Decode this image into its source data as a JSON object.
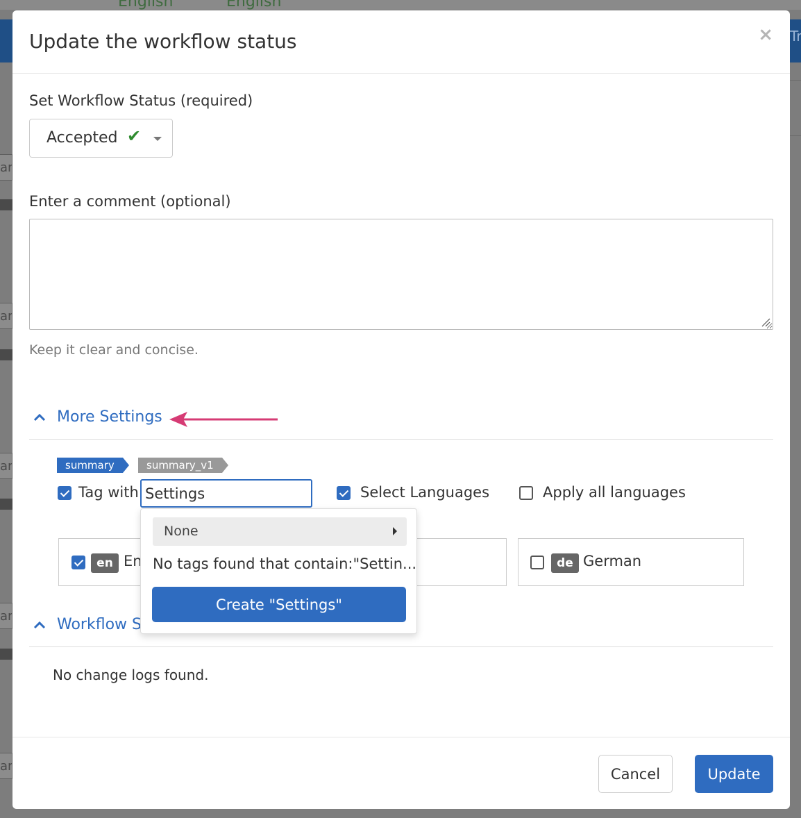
{
  "background": {
    "top_text": "English",
    "top_text_2": "English",
    "right_stub_text": "Tra",
    "left_stub_text": "ary"
  },
  "modal": {
    "title": "Update the workflow status",
    "close_label": "×"
  },
  "status": {
    "label": "Set Workflow Status (required)",
    "value": "Accepted",
    "value_icon": "checkmark-icon"
  },
  "comment": {
    "label": "Enter a comment (optional)",
    "value": "",
    "help": "Keep it clear and concise."
  },
  "more_settings": {
    "label": "More Settings",
    "breadcrumb": [
      "summary",
      "summary_v1"
    ],
    "tag_with_label": "Tag with",
    "tag_with_checked": true,
    "tag_input_value": "Settings",
    "select_languages_label": "Select Languages",
    "select_languages_checked": true,
    "apply_all_label": "Apply all languages",
    "apply_all_checked": false,
    "languages": [
      {
        "code": "en",
        "name": "En",
        "checked": true
      },
      {
        "code": "de",
        "name": "German",
        "checked": false
      }
    ],
    "dropdown": {
      "none_option": "None",
      "no_results": "No tags found that contain:\"Settin...",
      "create_label": "Create \"Settings\""
    }
  },
  "workflow_log": {
    "label": "Workflow St",
    "empty_text": "No change logs found."
  },
  "footer": {
    "cancel_label": "Cancel",
    "update_label": "Update"
  },
  "colors": {
    "accent": "#2f6cc0",
    "success": "#2e8b2e",
    "annotation_arrow": "#d63b74"
  }
}
